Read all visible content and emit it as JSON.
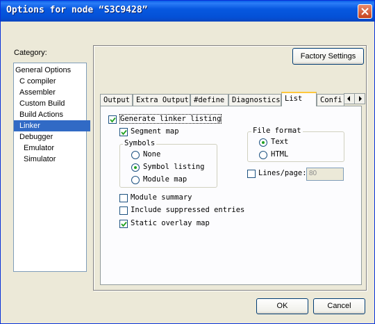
{
  "window": {
    "title": "Options for node “S3C9428”"
  },
  "category": {
    "label": "Category:",
    "items": [
      {
        "label": "General Options",
        "selected": false
      },
      {
        "label": "C compiler",
        "selected": false
      },
      {
        "label": "Assembler",
        "selected": false
      },
      {
        "label": "Custom Build",
        "selected": false
      },
      {
        "label": "Build Actions",
        "selected": false
      },
      {
        "label": "Linker",
        "selected": true
      },
      {
        "label": "Debugger",
        "selected": false
      },
      {
        "label": "Emulator",
        "selected": false
      },
      {
        "label": "Simulator",
        "selected": false
      }
    ]
  },
  "factory_button": "Factory Settings",
  "tabs": [
    "Output",
    "Extra Output",
    "#define",
    "Diagnostics",
    "List",
    "Confi"
  ],
  "active_tab": "List",
  "list": {
    "generate_listing": {
      "label": "Generate linker listing",
      "checked": true
    },
    "segment_map": {
      "label": "Segment map",
      "checked": true
    },
    "symbols": {
      "title": "Symbols",
      "none": {
        "label": "None",
        "selected": false
      },
      "symbol_listing": {
        "label": "Symbol listing",
        "selected": true
      },
      "module_map": {
        "label": "Module map",
        "selected": false
      }
    },
    "file_format": {
      "title": "File format",
      "text": {
        "label": "Text",
        "selected": true
      },
      "html": {
        "label": "HTML",
        "selected": false
      }
    },
    "lines_page": {
      "label": "Lines/page:",
      "checked": false,
      "value": "80"
    },
    "module_summary": {
      "label": "Module summary",
      "checked": false
    },
    "include_suppressed": {
      "label": "Include suppressed entries",
      "checked": false
    },
    "static_overlay": {
      "label": "Static overlay map",
      "checked": true
    }
  },
  "buttons": {
    "ok": "OK",
    "cancel": "Cancel"
  }
}
